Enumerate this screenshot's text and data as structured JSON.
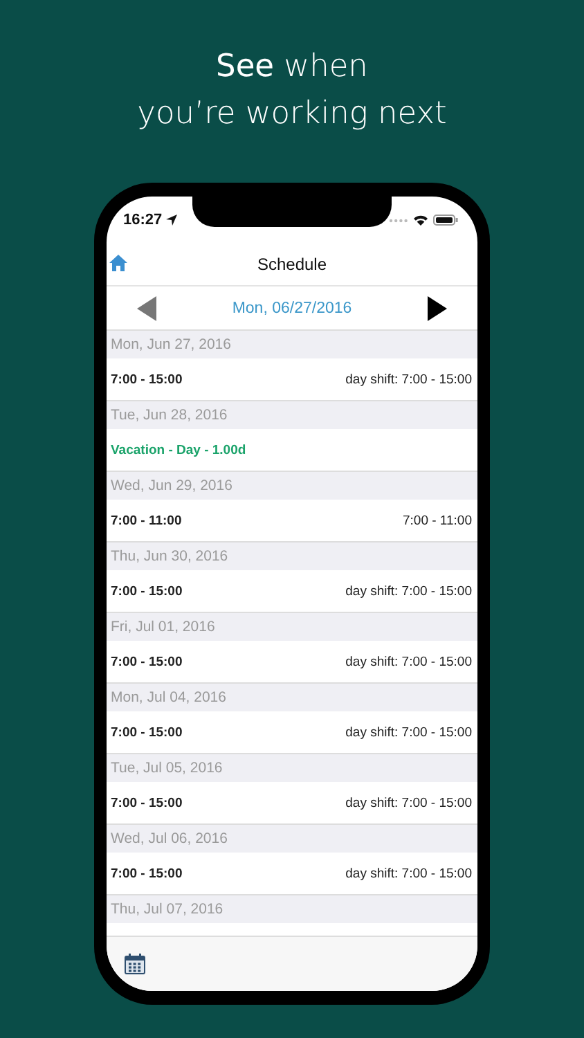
{
  "headline": {
    "lines": [
      "**See** when",
      "you’re working next"
    ]
  },
  "status_bar": {
    "time": "16:27"
  },
  "nav": {
    "title": "Schedule"
  },
  "date_bar": {
    "date": "Mon, 06/27/2016"
  },
  "days": [
    {
      "date": "Mon, Jun 27, 2016",
      "entries": [
        {
          "kind": "shift",
          "time": "7:00 - 15:00",
          "detail": "day shift: 7:00 - 15:00"
        }
      ]
    },
    {
      "date": "Tue, Jun 28, 2016",
      "entries": [
        {
          "kind": "absence",
          "label": "Vacation - Day - 1.00d"
        }
      ]
    },
    {
      "date": "Wed, Jun 29, 2016",
      "entries": [
        {
          "kind": "shift",
          "time": "7:00 - 11:00",
          "detail": "7:00 - 11:00"
        }
      ]
    },
    {
      "date": "Thu, Jun 30, 2016",
      "entries": [
        {
          "kind": "shift",
          "time": "7:00 - 15:00",
          "detail": "day shift: 7:00 - 15:00"
        }
      ]
    },
    {
      "date": "Fri, Jul 01, 2016",
      "entries": [
        {
          "kind": "shift",
          "time": "7:00 - 15:00",
          "detail": "day shift: 7:00 - 15:00"
        }
      ]
    },
    {
      "date": "Mon, Jul 04, 2016",
      "entries": [
        {
          "kind": "shift",
          "time": "7:00 - 15:00",
          "detail": "day shift: 7:00 - 15:00"
        }
      ]
    },
    {
      "date": "Tue, Jul 05, 2016",
      "entries": [
        {
          "kind": "shift",
          "time": "7:00 - 15:00",
          "detail": "day shift: 7:00 - 15:00"
        }
      ]
    },
    {
      "date": "Wed, Jul 06, 2016",
      "entries": [
        {
          "kind": "shift",
          "time": "7:00 - 15:00",
          "detail": "day shift: 7:00 - 15:00"
        }
      ]
    },
    {
      "date": "Thu, Jul 07, 2016"
    }
  ]
}
